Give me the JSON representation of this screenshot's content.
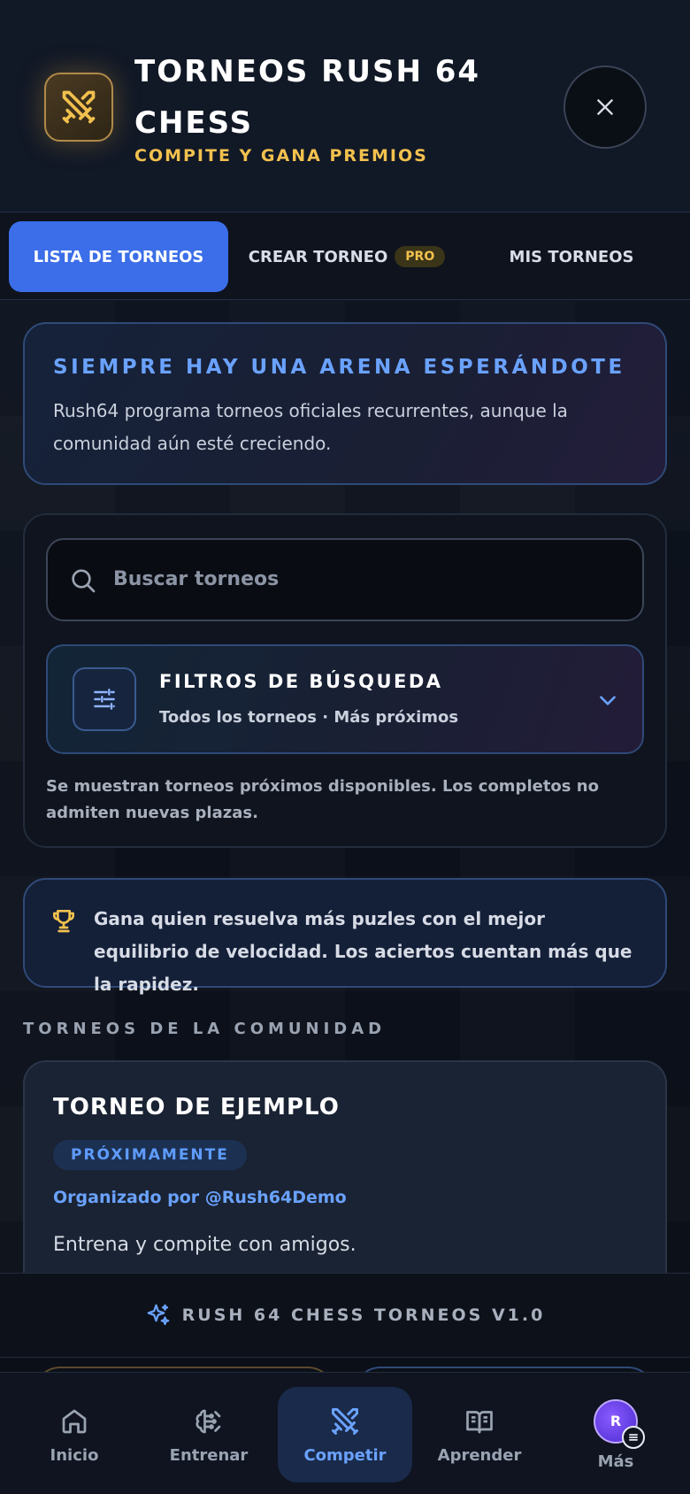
{
  "header": {
    "title": "TORNEOS RUSH 64 CHESS",
    "subtitle": "COMPITE Y GANA PREMIOS",
    "logo_icon": "crossed-swords-icon",
    "close_icon": "close-icon"
  },
  "tabs": [
    {
      "label": "LISTA DE TORNEOS",
      "active": true
    },
    {
      "label": "CREAR TORNEO",
      "badge": "PRO",
      "active": false
    },
    {
      "label": "MIS TORNEOS",
      "active": false
    }
  ],
  "arena": {
    "title": "SIEMPRE HAY UNA ARENA ESPERÁNDOTE",
    "text": "Rush64 programa torneos oficiales recurrentes, aunque la comunidad aún esté creciendo."
  },
  "search": {
    "placeholder": "Buscar torneos",
    "filters_title": "FILTROS DE BÚSQUEDA",
    "filters_summary": "Todos los torneos · Más próximos",
    "note": "Se muestran torneos próximos disponibles. Los completos no admiten nuevas plazas."
  },
  "info": {
    "text": "Gana quien resuelva más puzles con el mejor equilibrio de velocidad. Los aciertos cuentan más que la rapidez."
  },
  "community": {
    "section_label": "TORNEOS DE LA COMUNIDAD",
    "tournaments": [
      {
        "title": "TORNEO DE EJEMPLO",
        "status": "PRÓXIMAMENTE",
        "organizer": "Organizado por @Rush64Demo",
        "description": "Entrena y compite con amigos."
      }
    ]
  },
  "version": {
    "text": "RUSH 64 CHESS TORNEOS V1.0"
  },
  "nav": {
    "items": [
      {
        "label": "Inicio",
        "icon": "home-icon"
      },
      {
        "label": "Entrenar",
        "icon": "brain-icon"
      },
      {
        "label": "Competir",
        "icon": "crossed-swords-icon",
        "active": true
      },
      {
        "label": "Aprender",
        "icon": "book-icon"
      },
      {
        "label": "Más",
        "icon": "avatar",
        "avatar_initial": "R"
      }
    ]
  },
  "colors": {
    "accent": "#3b6ee8",
    "accent_text": "#6aa2ff",
    "gold": "#f2c14e",
    "background": "#0b0f18"
  }
}
